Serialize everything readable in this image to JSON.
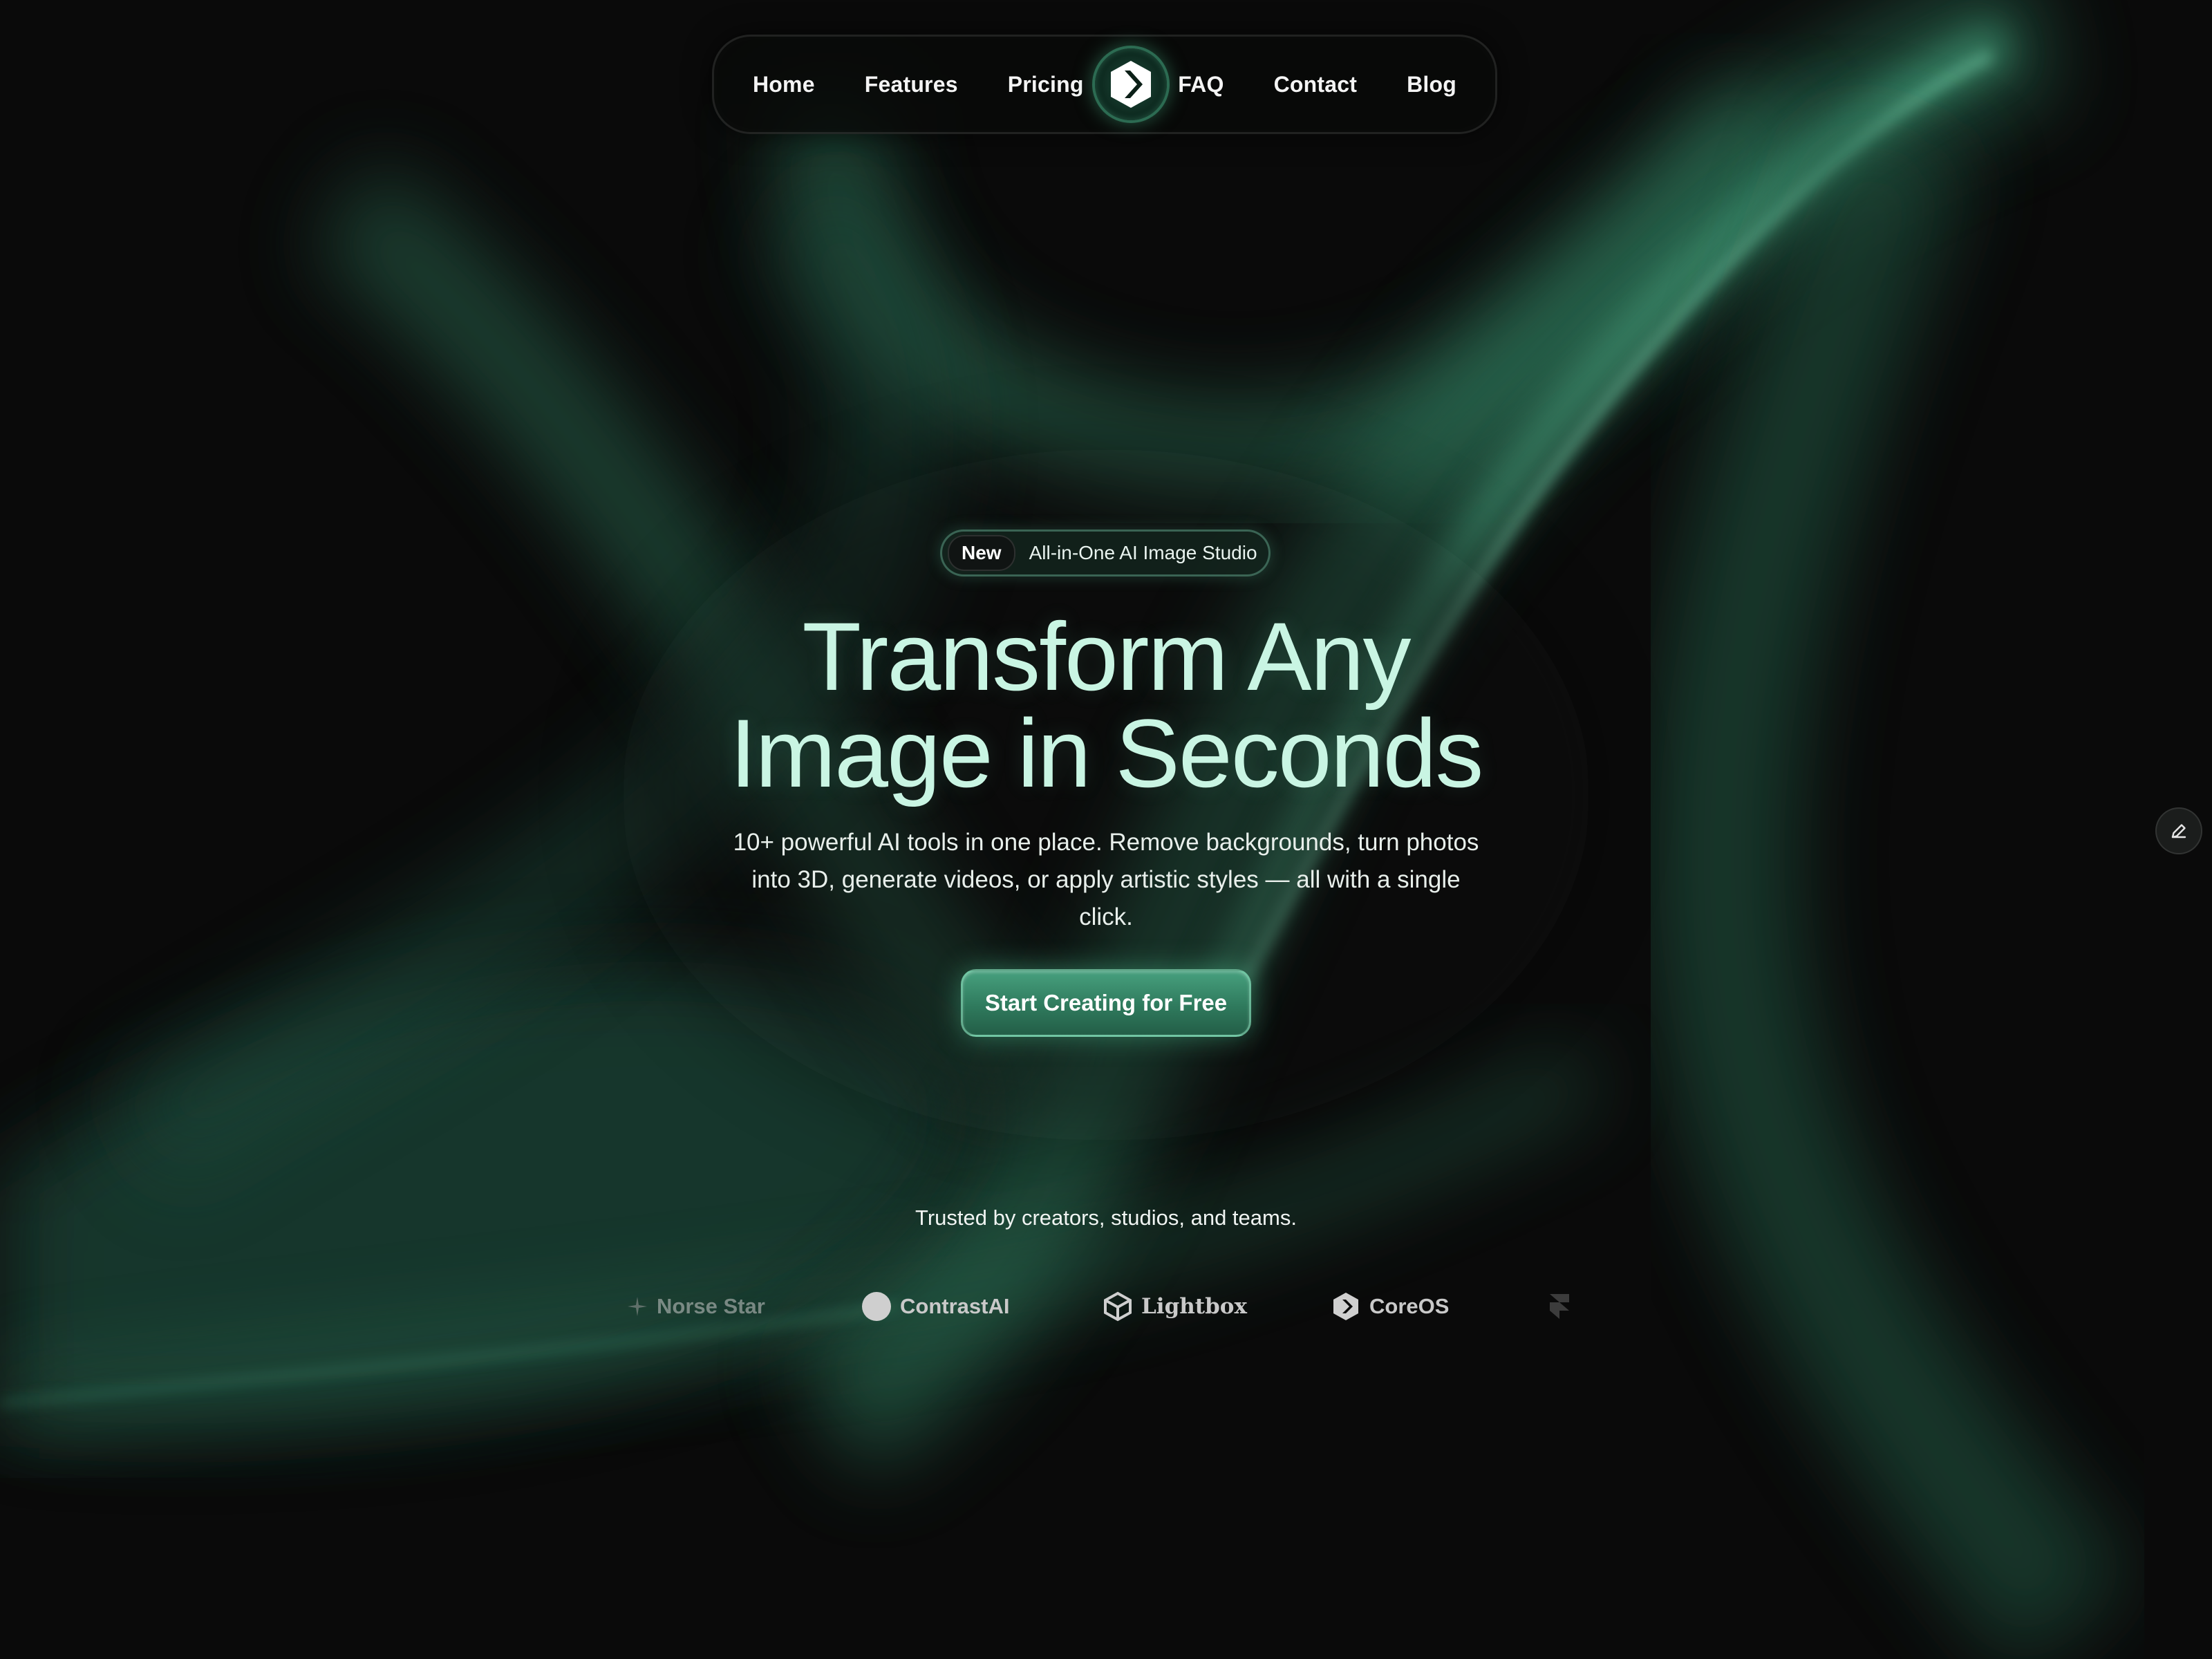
{
  "nav": {
    "left_links": [
      "Home",
      "Features",
      "Pricing"
    ],
    "right_links": [
      "FAQ",
      "Contact",
      "Blog"
    ],
    "logo_icon": "chevron-hexagon-logo"
  },
  "hero": {
    "badge_pill": "New",
    "badge_text": "All-in-One AI Image Studio",
    "title_line1": "Transform Any",
    "title_line2": "Image in Seconds",
    "subtitle": "10+ powerful AI tools in one place. Remove backgrounds, turn photos into 3D, generate videos, or apply artistic styles — all with a single click.",
    "cta_label": "Start Creating for Free"
  },
  "trusted": {
    "text": "Trusted by creators, studios, and teams.",
    "logos": [
      "Norse Star",
      "ContrastAI",
      "Lightbox",
      "CoreOS",
      ""
    ]
  },
  "colors": {
    "background": "#0a0a0a",
    "accent": "#3d8f6e",
    "title": "#c9f5e3"
  },
  "icons": {
    "edit": "pencil-icon"
  }
}
